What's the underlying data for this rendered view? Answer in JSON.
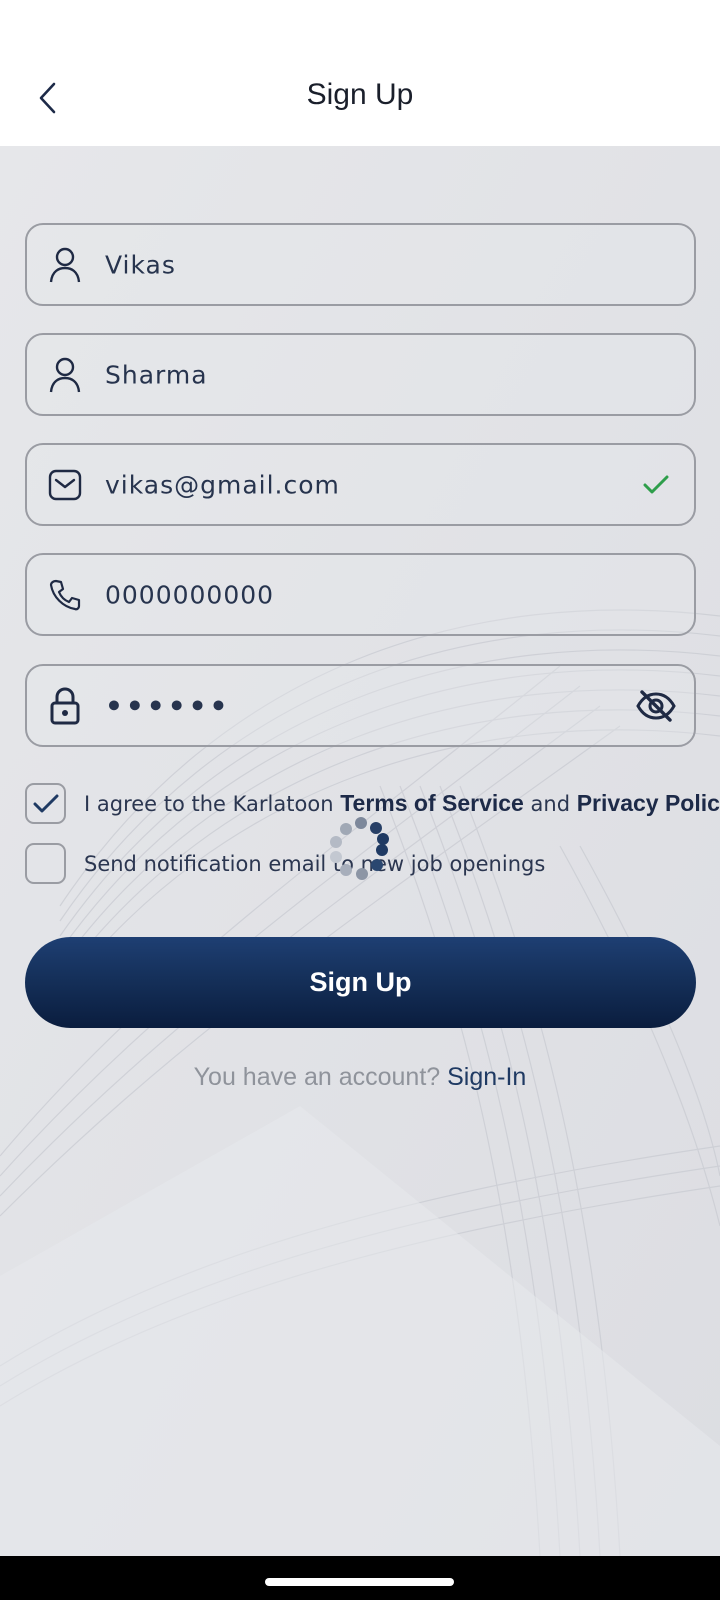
{
  "header": {
    "title": "Sign Up",
    "back_icon": "chevron-left-icon"
  },
  "form": {
    "first_name": {
      "value": "Vikas",
      "icon": "person-icon"
    },
    "last_name": {
      "value": "Sharma",
      "icon": "person-icon"
    },
    "email": {
      "value": "vikas@gmail.com",
      "icon": "mail-icon",
      "status_icon": "check-icon",
      "status_color": "#2e9e4b"
    },
    "phone": {
      "value": "0000000000",
      "icon": "phone-icon"
    },
    "password": {
      "value": "••••••",
      "icon": "lock-icon",
      "toggle_icon": "eye-off-icon"
    }
  },
  "terms": {
    "checked": true,
    "prefix": "I agree to the Karlatoon ",
    "terms_link": "Terms of Service",
    "middle": " and ",
    "privacy_link": "Privacy Policy"
  },
  "notifications": {
    "checked": false,
    "label": "Send notification email to new job openings"
  },
  "signup_button": {
    "label": "Sign Up",
    "color": "#15305a"
  },
  "account_prompt": {
    "text": "You have an account? ",
    "link": "Sign-In"
  },
  "loading_icon": "spinner-icon"
}
